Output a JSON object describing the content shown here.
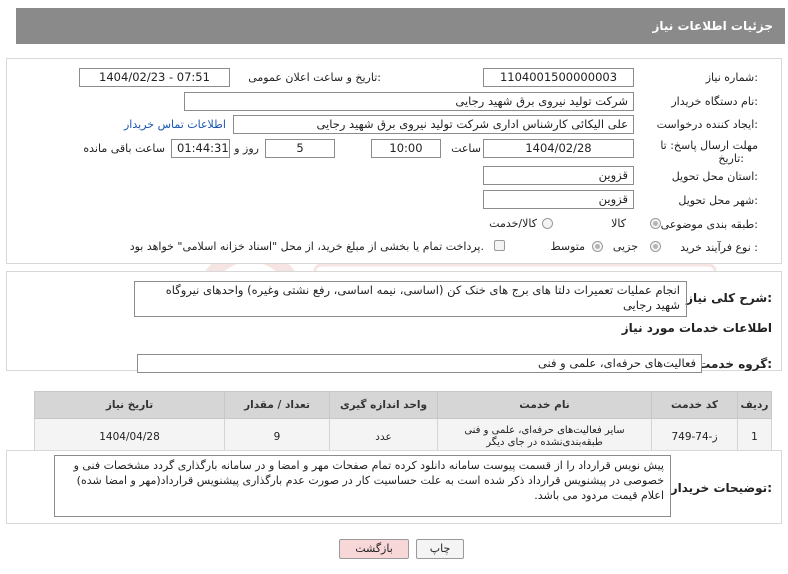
{
  "header": {
    "title": "جزئیات اطلاعات نیاز"
  },
  "fields": {
    "need_number_label": "شماره نیاز:",
    "need_number": "1104001500000003",
    "announce_label": "تاریخ و ساعت اعلان عمومی:",
    "announce_value": "1404/02/23 - 07:51",
    "buyer_label": "نام دستگاه خریدار:",
    "buyer_value": "شرکت تولید نیروی برق شهید رجایی",
    "creator_label": "ایجاد کننده درخواست:",
    "creator_value": "علی الیکائی کارشناس اداری شرکت تولید نیروی برق شهید رجایی",
    "contact_link": "اطلاعات تماس خریدار",
    "deadline_label_1": "مهلت ارسال پاسخ: تا",
    "deadline_label_2": "تاریخ:",
    "deadline_date": "1404/02/28",
    "time_label": "ساعت",
    "deadline_time": "10:00",
    "days_value": "5",
    "days_label": "روز و",
    "remaining_time": "01:44:31",
    "remaining_label": "ساعت باقی مانده",
    "province_label": "استان محل تحویل:",
    "province_value": "قزوین",
    "city_label": "شهر محل تحویل:",
    "city_value": "قزوین",
    "category_label": "طبقه بندی موضوعی:",
    "category_goods": "کالا",
    "category_goods_service": "کالا/خدمت",
    "purchase_type_label": "نوع فرآیند خرید :",
    "purchase_partial": "جزیی",
    "purchase_medium": "متوسط",
    "payment_note": "پرداخت تمام یا بخشی از مبلغ خرید، از محل \"اسناد خزانه اسلامی\" خواهد بود."
  },
  "description": {
    "label": "شرح کلی نیاز:",
    "text": "انجام عملیات تعمیرات دلتا های برج های خنک کن (اساسی، نیمه اساسی، رفع نشتی وغیره)  واحدهای نیروگاه شهید رجایی"
  },
  "services": {
    "section_title": "اطلاعات خدمات مورد نیاز",
    "group_label": "گروه خدمت:",
    "group_value": "فعالیت‌های حرفه‌ای، علمی و فنی",
    "columns": [
      "ردیف",
      "کد خدمت",
      "نام خدمت",
      "واحد اندازه گیری",
      "تعداد / مقدار",
      "تاریخ نیاز"
    ],
    "rows": [
      [
        "1",
        "ز-74-749",
        "سایر فعالیت‌های حرفه‌ای، علمی و فنی طبقه‌بندی‌نشده در جای دیگر",
        "عدد",
        "9",
        "1404/04/28"
      ]
    ]
  },
  "buyer_notes": {
    "label": "توضیحات خریدار:",
    "text": "پیش نویس قرارداد را از قسمت پیوست سامانه دانلود کرده تمام صفحات مهر و امضا و در سامانه بارگذاری گردد مشخصات فنی و خصوصی در پیشنویس قرارداد ذکر شده است به علت حساسیت کار در صورت عدم بارگذاری پیشنویس قرارداد(مهر و امضا شده) اعلام قیمت مردود می باشد."
  },
  "buttons": {
    "print": "چاپ",
    "back": "بازگشت"
  },
  "colors": {
    "header_bg": "#8a8a8a",
    "link": "#1a55b0",
    "back_btn_bg": "#f7d7d7",
    "watermark": "#c0392b"
  }
}
